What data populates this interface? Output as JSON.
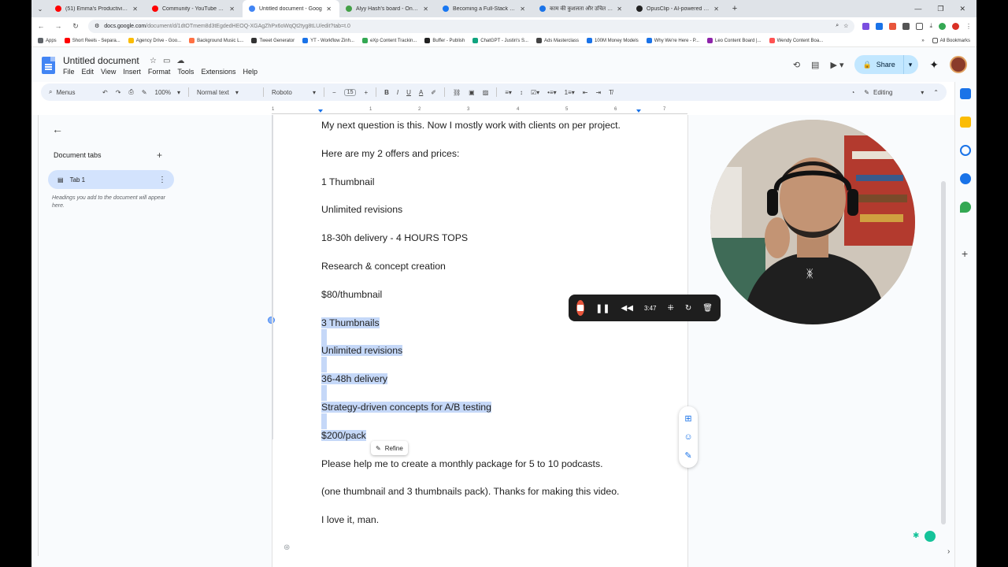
{
  "browser": {
    "tabs": [
      {
        "label": "(51) Emma's Productivity Lab",
        "color": "#ff0000"
      },
      {
        "label": "Community - YouTube Studio",
        "color": "#ff0000"
      },
      {
        "label": "Untitled document - Goog",
        "color": "#4285f4",
        "active": true
      },
      {
        "label": "Alyy Hash's board - Onlinebo",
        "color": "#43a047"
      },
      {
        "label": "Becoming a Full-Stack Facebo",
        "color": "#1877f2"
      },
      {
        "label": "काम की कुशलता और उचित मूल्य",
        "color": "#1a73e8"
      },
      {
        "label": "OpusClip - AI-powered Video",
        "color": "#222222"
      }
    ],
    "url_host": "docs.google.com",
    "url_path": "/document/d/1dtOTmem8d3tEgdedHEOQ-XGAgZhPx6oWqQt2tyg8tLU/edit?tab=t.0",
    "bookmarks": [
      {
        "label": "Apps",
        "color": "#5f6368"
      },
      {
        "label": "Short Reels - Separa...",
        "color": "#ff0000"
      },
      {
        "label": "Agency Drive - Goo...",
        "color": "#fbbc04"
      },
      {
        "label": "Background Music L...",
        "color": "#ff7043"
      },
      {
        "label": "Tweet Generator",
        "color": "#333333"
      },
      {
        "label": "YT - Workflow Zinh...",
        "color": "#1a73e8"
      },
      {
        "label": "eXp Content Trackin...",
        "color": "#34a853"
      },
      {
        "label": "Buffer - Publish",
        "color": "#222222"
      },
      {
        "label": "ChatGPT - Justin's S...",
        "color": "#10a37f"
      },
      {
        "label": "Ads Masterclass",
        "color": "#444444"
      },
      {
        "label": "100M Money Models",
        "color": "#1a73e8"
      },
      {
        "label": "Why We're Here - P...",
        "color": "#1a73e8"
      },
      {
        "label": "Leo Content Board |...",
        "color": "#8e24aa"
      },
      {
        "label": "Wendy Content Boa...",
        "color": "#ff5252"
      }
    ],
    "all_bookmarks": "All Bookmarks"
  },
  "docs": {
    "title": "Untitled document",
    "menu": [
      "File",
      "Edit",
      "View",
      "Insert",
      "Format",
      "Tools",
      "Extensions",
      "Help"
    ],
    "share_label": "Share",
    "toolbar": {
      "search": "Menus",
      "zoom": "100%",
      "style": "Normal text",
      "font": "Roboto",
      "font_size": "15",
      "mode": "Editing"
    },
    "sidebar": {
      "heading": "Document tabs",
      "tab_label": "Tab 1",
      "hint": "Headings you add to the document will appear here."
    },
    "ruler_marks": [
      "1",
      "1",
      "2",
      "3",
      "4",
      "5",
      "6",
      "7"
    ],
    "paragraphs": [
      {
        "text": "My next question is this. Now I mostly work with clients on per project.",
        "selected": false
      },
      {
        "text": "Here are my 2 offers and prices:",
        "selected": false
      },
      {
        "text": "1 Thumbnail",
        "selected": false
      },
      {
        "text": "Unlimited revisions",
        "selected": false
      },
      {
        "text": "18-30h delivery - 4 HOURS TOPS",
        "selected": false
      },
      {
        "text": "Research & concept creation",
        "selected": false
      },
      {
        "text": "$80/thumbnail",
        "selected": false
      },
      {
        "text": "3 Thumbnails",
        "selected": true
      },
      {
        "text": "Unlimited revisions",
        "selected": true
      },
      {
        "text": "36-48h delivery",
        "selected": true
      },
      {
        "text": "Strategy-driven concepts for A/B testing",
        "selected": true
      },
      {
        "text": "$200/pack",
        "selected": true
      },
      {
        "text": "Please help me to create a monthly package for 5 to 10 podcasts.",
        "selected": false
      },
      {
        "text": "(one thumbnail and 3 thumbnails pack). Thanks for making this video.",
        "selected": false
      },
      {
        "text": "I love it, man.",
        "selected": false
      }
    ],
    "refine_label": "Refine"
  },
  "recorder": {
    "time": "3:47"
  },
  "colors": {
    "selection": "#c5d8f8",
    "accent": "#1a73e8",
    "share_bg": "#c2e7ff",
    "record_red": "#e8553b"
  }
}
